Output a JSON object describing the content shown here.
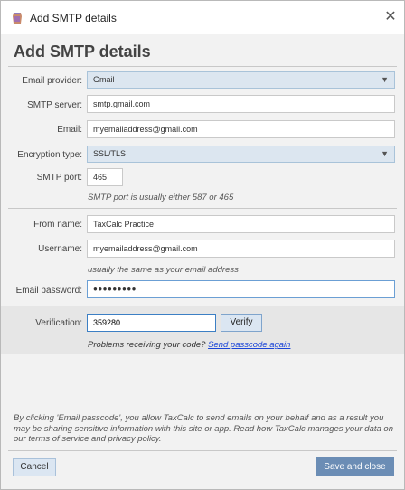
{
  "window": {
    "title": "Add SMTP details"
  },
  "heading": "Add SMTP details",
  "fields": {
    "email_provider": {
      "label": "Email provider:",
      "value": "Gmail"
    },
    "smtp_server": {
      "label": "SMTP server:",
      "value": "smtp.gmail.com"
    },
    "email": {
      "label": "Email:",
      "value": "myemailaddress@gmail.com"
    },
    "encryption": {
      "label": "Encryption type:",
      "value": "SSL/TLS"
    },
    "smtp_port": {
      "label": "SMTP port:",
      "value": "465",
      "hint": "SMTP port is usually either 587 or 465"
    },
    "from_name": {
      "label": "From name:",
      "value": "TaxCalc Practice"
    },
    "username": {
      "label": "Username:",
      "value": "myemailaddress@gmail.com",
      "hint": "usually the same as your email address"
    },
    "email_password": {
      "label": "Email password:",
      "value": "●●●●●●●●●"
    },
    "verification": {
      "label": "Verification:",
      "value": "359280"
    }
  },
  "verify_button": "Verify",
  "verification_help": {
    "text": "Problems receiving your code?",
    "link": "Send passcode again"
  },
  "disclaimer": "By clicking 'Email passcode', you allow TaxCalc to send emails on your behalf and as a result you may be sharing sensitive information with this site or app. Read how TaxCalc manages your data on our terms of service and privacy policy.",
  "buttons": {
    "cancel": "Cancel",
    "save": "Save and close"
  },
  "colors": {
    "accent": "#6b8db5",
    "select_bg": "#dce6f0",
    "link": "#1a44d8"
  }
}
